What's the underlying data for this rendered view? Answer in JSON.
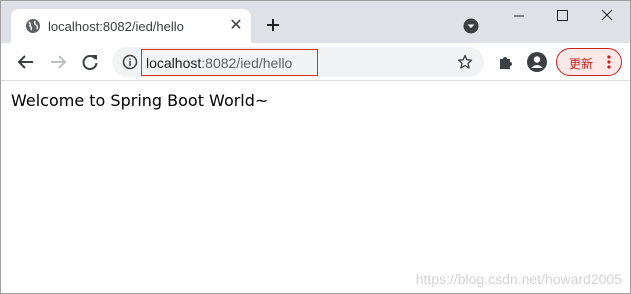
{
  "tab": {
    "title": "localhost:8082/ied/hello",
    "close_glyph": "✕",
    "favicon": "globe-icon"
  },
  "toolbar": {
    "url_host": "localhost",
    "url_rest": ":8082/ied/hello",
    "update_label": "更新"
  },
  "page": {
    "welcome_text": "Welcome to Spring Boot World~"
  },
  "watermark": "https://blog.csdn.net/howard2005",
  "colors": {
    "tabstrip": "#dee1e6",
    "url_highlight_border": "#d93025",
    "update_accent": "#c5221f"
  }
}
